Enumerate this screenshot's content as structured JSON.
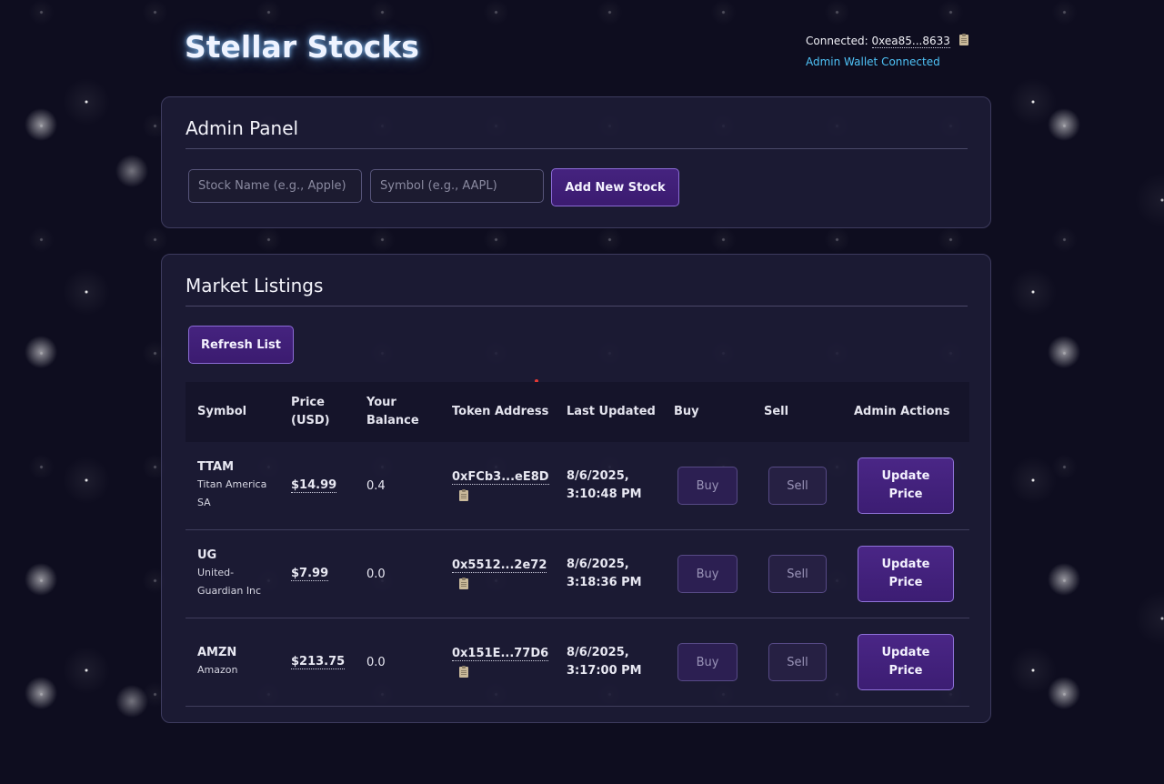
{
  "header": {
    "title": "Stellar Stocks",
    "connected_label": "Connected:",
    "wallet_address": "0xea85...8633",
    "admin_status": "Admin Wallet Connected"
  },
  "admin_panel": {
    "title": "Admin Panel",
    "stock_name_placeholder": "Stock Name (e.g., Apple)",
    "symbol_placeholder": "Symbol (e.g., AAPL)",
    "add_button": "Add New Stock"
  },
  "market": {
    "title": "Market Listings",
    "refresh_button": "Refresh List",
    "columns": {
      "symbol": "Symbol",
      "price": "Price (USD)",
      "balance": "Your Balance",
      "token": "Token Address",
      "updated": "Last Updated",
      "buy": "Buy",
      "sell": "Sell",
      "admin": "Admin Actions"
    },
    "rows": [
      {
        "symbol": "TTAM",
        "company": "Titan America SA",
        "price": "$14.99",
        "balance": "0.4",
        "token": "0xFCb3...eE8D",
        "updated": "8/6/2025, 3:10:48 PM",
        "buy": "Buy",
        "sell": "Sell",
        "update": "Update Price"
      },
      {
        "symbol": "UG",
        "company": "United-Guardian Inc",
        "price": "$7.99",
        "balance": "0.0",
        "token": "0x5512...2e72",
        "updated": "8/6/2025, 3:18:36 PM",
        "buy": "Buy",
        "sell": "Sell",
        "update": "Update Price"
      },
      {
        "symbol": "AMZN",
        "company": "Amazon",
        "price": "$213.75",
        "balance": "0.0",
        "token": "0x151E...77D6",
        "updated": "8/6/2025, 3:17:00 PM",
        "buy": "Buy",
        "sell": "Sell",
        "update": "Update Price"
      }
    ]
  },
  "colors": {
    "background": "#0e0d1f",
    "accent_purple": "#45237f",
    "admin_status": "#4fc3f7",
    "notification_dot": "#e53935"
  },
  "icons": {
    "copy": "clipboard-icon"
  }
}
